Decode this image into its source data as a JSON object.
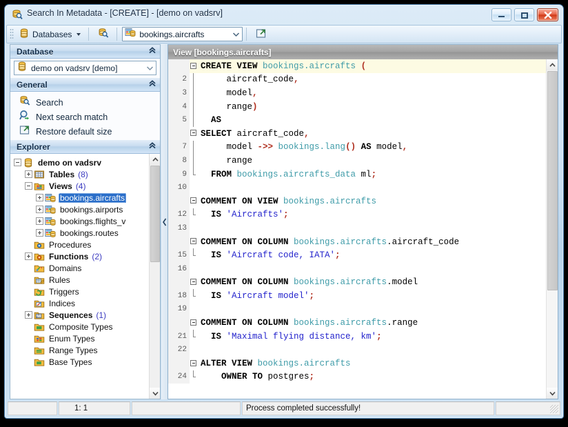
{
  "window": {
    "title": "Search In Metadata - [CREATE] - [demo on vadsrv]",
    "icon": "search-database-icon",
    "minimize_label": "Minimize",
    "maximize_label": "Maximize",
    "close_label": "Close"
  },
  "toolbar": {
    "databases_label": "Databases",
    "search_icon": "search-database-icon",
    "combo_value": "bookings.aircrafts",
    "combo_icon": "view-object-icon",
    "restore_icon": "restore-size-icon"
  },
  "panels": {
    "database": {
      "title": "Database",
      "collapse_icon": "chevron-double-up-icon",
      "combo_value": "demo on vadsrv [demo]",
      "combo_icon": "database-icon"
    },
    "general": {
      "title": "General",
      "collapse_icon": "chevron-double-up-icon",
      "items": [
        {
          "label": "Search",
          "icon": "search-database-icon"
        },
        {
          "label": "Next search match",
          "icon": "search-next-icon"
        },
        {
          "label": "Restore default size",
          "icon": "restore-size-icon"
        }
      ]
    },
    "explorer": {
      "title": "Explorer",
      "collapse_icon": "chevron-double-up-icon",
      "tree": [
        {
          "label": "demo on vadsrv",
          "count": "",
          "indent": 0,
          "expander": "minus",
          "icon": "database-icon",
          "bold": true,
          "selected": false
        },
        {
          "label": "Tables",
          "count": "(8)",
          "indent": 1,
          "expander": "plus",
          "icon": "table-folder-icon",
          "bold": true,
          "selected": false
        },
        {
          "label": "Views",
          "count": "(4)",
          "indent": 1,
          "expander": "minus",
          "icon": "view-folder-icon",
          "bold": true,
          "selected": false
        },
        {
          "label": "bookings.aircrafts",
          "count": "",
          "indent": 2,
          "expander": "plus",
          "icon": "view-object-icon",
          "bold": false,
          "selected": true
        },
        {
          "label": "bookings.airports",
          "count": "",
          "indent": 2,
          "expander": "plus",
          "icon": "view-object-icon",
          "bold": false,
          "selected": false
        },
        {
          "label": "bookings.flights_v",
          "count": "",
          "indent": 2,
          "expander": "plus",
          "icon": "view-object-icon",
          "bold": false,
          "selected": false
        },
        {
          "label": "bookings.routes",
          "count": "",
          "indent": 2,
          "expander": "plus",
          "icon": "view-object-icon",
          "bold": false,
          "selected": false
        },
        {
          "label": "Procedures",
          "count": "",
          "indent": 1,
          "expander": "none",
          "icon": "procedure-folder-icon",
          "bold": false,
          "selected": false
        },
        {
          "label": "Functions",
          "count": "(2)",
          "indent": 1,
          "expander": "plus",
          "icon": "function-folder-icon",
          "bold": true,
          "selected": false
        },
        {
          "label": "Domains",
          "count": "",
          "indent": 1,
          "expander": "none",
          "icon": "domain-folder-icon",
          "bold": false,
          "selected": false
        },
        {
          "label": "Rules",
          "count": "",
          "indent": 1,
          "expander": "none",
          "icon": "rule-folder-icon",
          "bold": false,
          "selected": false
        },
        {
          "label": "Triggers",
          "count": "",
          "indent": 1,
          "expander": "none",
          "icon": "trigger-folder-icon",
          "bold": false,
          "selected": false
        },
        {
          "label": "Indices",
          "count": "",
          "indent": 1,
          "expander": "none",
          "icon": "index-folder-icon",
          "bold": false,
          "selected": false
        },
        {
          "label": "Sequences",
          "count": "(1)",
          "indent": 1,
          "expander": "plus",
          "icon": "sequence-folder-icon",
          "bold": true,
          "selected": false
        },
        {
          "label": "Composite Types",
          "count": "",
          "indent": 1,
          "expander": "none",
          "icon": "composite-type-icon",
          "bold": false,
          "selected": false
        },
        {
          "label": "Enum Types",
          "count": "",
          "indent": 1,
          "expander": "none",
          "icon": "enum-type-icon",
          "bold": false,
          "selected": false
        },
        {
          "label": "Range Types",
          "count": "",
          "indent": 1,
          "expander": "none",
          "icon": "range-type-icon",
          "bold": false,
          "selected": false
        },
        {
          "label": "Base Types",
          "count": "",
          "indent": 1,
          "expander": "none",
          "icon": "base-type-icon",
          "bold": false,
          "selected": false
        }
      ]
    }
  },
  "editor": {
    "header_title": "View [bookings.aircrafts]",
    "lines": [
      {
        "n": "",
        "fold": "box",
        "current": true,
        "tokens": [
          {
            "t": "CREATE VIEW ",
            "c": "kw"
          },
          {
            "t": "bookings.aircrafts",
            "c": "idn"
          },
          {
            "t": " ",
            "c": "pl"
          },
          {
            "t": "(",
            "c": "op"
          }
        ]
      },
      {
        "n": "2",
        "fold": "line",
        "current": false,
        "tokens": [
          {
            "t": "     aircraft_code",
            "c": "pl"
          },
          {
            "t": ",",
            "c": "op"
          }
        ]
      },
      {
        "n": "3",
        "fold": "line",
        "current": false,
        "tokens": [
          {
            "t": "     model",
            "c": "pl"
          },
          {
            "t": ",",
            "c": "op"
          }
        ]
      },
      {
        "n": "4",
        "fold": "line",
        "current": false,
        "tokens": [
          {
            "t": "     range",
            "c": "pl"
          },
          {
            "t": ")",
            "c": "op"
          }
        ]
      },
      {
        "n": "5",
        "fold": "line",
        "current": false,
        "tokens": [
          {
            "t": "  AS",
            "c": "kw"
          }
        ]
      },
      {
        "n": "",
        "fold": "box",
        "current": false,
        "tokens": [
          {
            "t": "SELECT ",
            "c": "kw"
          },
          {
            "t": "aircraft_code",
            "c": "pl"
          },
          {
            "t": ",",
            "c": "op"
          }
        ]
      },
      {
        "n": "7",
        "fold": "line",
        "current": false,
        "tokens": [
          {
            "t": "     model ",
            "c": "pl"
          },
          {
            "t": "->>",
            "c": "op"
          },
          {
            "t": " ",
            "c": "pl"
          },
          {
            "t": "bookings.lang",
            "c": "idn"
          },
          {
            "t": "()",
            "c": "op"
          },
          {
            "t": " ",
            "c": "pl"
          },
          {
            "t": "AS",
            "c": "kw"
          },
          {
            "t": " model",
            "c": "pl"
          },
          {
            "t": ",",
            "c": "op"
          }
        ]
      },
      {
        "n": "8",
        "fold": "line",
        "current": false,
        "tokens": [
          {
            "t": "     range",
            "c": "pl"
          }
        ]
      },
      {
        "n": "9",
        "fold": "endl",
        "current": false,
        "tokens": [
          {
            "t": "  FROM ",
            "c": "kw"
          },
          {
            "t": "bookings.aircrafts_data",
            "c": "idn"
          },
          {
            "t": " ml",
            "c": "pl"
          },
          {
            "t": ";",
            "c": "op"
          }
        ]
      },
      {
        "n": "10",
        "fold": "none",
        "current": false,
        "tokens": []
      },
      {
        "n": "",
        "fold": "box",
        "current": false,
        "tokens": [
          {
            "t": "COMMENT ON VIEW ",
            "c": "kw"
          },
          {
            "t": "bookings.aircrafts",
            "c": "idn"
          }
        ]
      },
      {
        "n": "12",
        "fold": "endl",
        "current": false,
        "tokens": [
          {
            "t": "  IS ",
            "c": "kw"
          },
          {
            "t": "'Aircrafts'",
            "c": "str"
          },
          {
            "t": ";",
            "c": "op"
          }
        ]
      },
      {
        "n": "13",
        "fold": "none",
        "current": false,
        "tokens": []
      },
      {
        "n": "",
        "fold": "box",
        "current": false,
        "tokens": [
          {
            "t": "COMMENT ON COLUMN ",
            "c": "kw"
          },
          {
            "t": "bookings.aircrafts",
            "c": "idn"
          },
          {
            "t": ".aircraft_code",
            "c": "pl"
          }
        ]
      },
      {
        "n": "15",
        "fold": "endl",
        "current": false,
        "tokens": [
          {
            "t": "  IS ",
            "c": "kw"
          },
          {
            "t": "'Aircraft code, IATA'",
            "c": "str"
          },
          {
            "t": ";",
            "c": "op"
          }
        ]
      },
      {
        "n": "16",
        "fold": "none",
        "current": false,
        "tokens": []
      },
      {
        "n": "",
        "fold": "box",
        "current": false,
        "tokens": [
          {
            "t": "COMMENT ON COLUMN ",
            "c": "kw"
          },
          {
            "t": "bookings.aircrafts",
            "c": "idn"
          },
          {
            "t": ".model",
            "c": "pl"
          }
        ]
      },
      {
        "n": "18",
        "fold": "endl",
        "current": false,
        "tokens": [
          {
            "t": "  IS ",
            "c": "kw"
          },
          {
            "t": "'Aircraft model'",
            "c": "str"
          },
          {
            "t": ";",
            "c": "op"
          }
        ]
      },
      {
        "n": "19",
        "fold": "none",
        "current": false,
        "tokens": []
      },
      {
        "n": "",
        "fold": "box",
        "current": false,
        "tokens": [
          {
            "t": "COMMENT ON COLUMN ",
            "c": "kw"
          },
          {
            "t": "bookings.aircrafts",
            "c": "idn"
          },
          {
            "t": ".range",
            "c": "pl"
          }
        ]
      },
      {
        "n": "21",
        "fold": "endl",
        "current": false,
        "tokens": [
          {
            "t": "  IS ",
            "c": "kw"
          },
          {
            "t": "'Maximal flying distance, km'",
            "c": "str"
          },
          {
            "t": ";",
            "c": "op"
          }
        ]
      },
      {
        "n": "22",
        "fold": "none",
        "current": false,
        "tokens": []
      },
      {
        "n": "",
        "fold": "box",
        "current": false,
        "tokens": [
          {
            "t": "ALTER VIEW ",
            "c": "kw"
          },
          {
            "t": "bookings.aircrafts",
            "c": "idn"
          }
        ]
      },
      {
        "n": "24",
        "fold": "endl",
        "current": false,
        "tokens": [
          {
            "t": "    OWNER TO ",
            "c": "kw"
          },
          {
            "t": "postgres",
            "c": "pl"
          },
          {
            "t": ";",
            "c": "op"
          }
        ]
      }
    ]
  },
  "statusbar": {
    "cell1": "",
    "cursor_position": "1:  1",
    "cell3": "",
    "message": "Process completed successfully!",
    "cell5": ""
  },
  "colors": {
    "selection_blue": "#2a6ec9",
    "keyword": "#000000",
    "identifier": "#3e9ba8",
    "string": "#2222cc",
    "operator": "#b03020",
    "current_line": "#fdfbe3",
    "count_blue": "#3a3ac0"
  }
}
